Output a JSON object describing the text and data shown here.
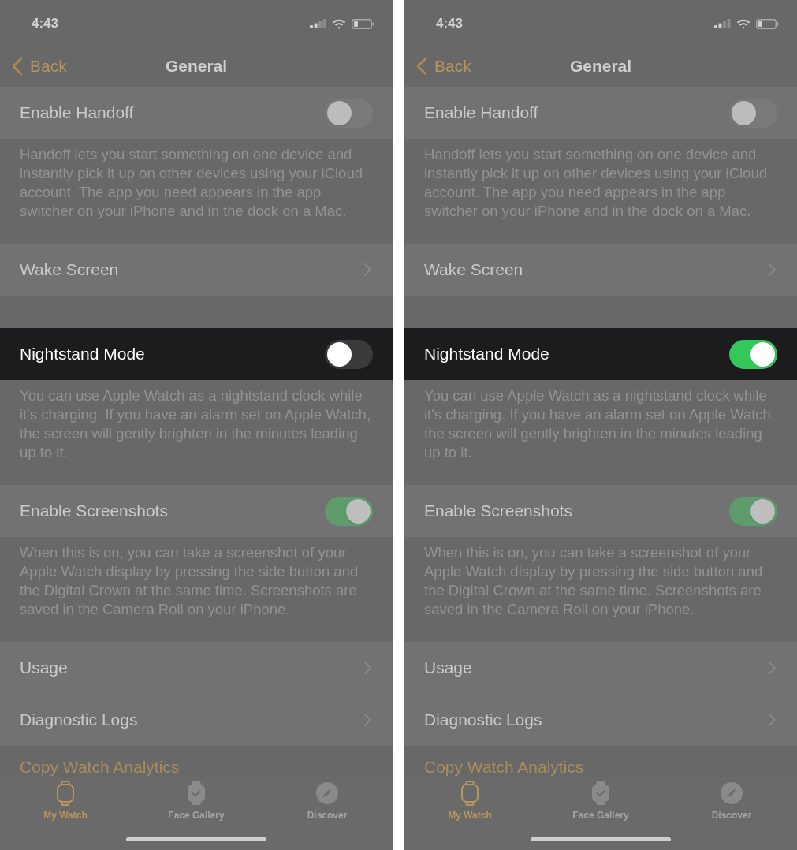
{
  "screens": [
    {
      "status_bar": {
        "time": "4:43"
      },
      "nav_bar": {
        "back": "Back",
        "title": "General"
      },
      "sections": [
        {
          "rows": [
            {
              "kind": "toggle",
              "label": "Enable Handoff",
              "on": false,
              "highlighted": false
            }
          ],
          "footer": "Handoff lets you start something on one device and instantly pick it up on other devices using your iCloud account. The app you need appears in the app switcher on your iPhone and in the dock on a Mac."
        },
        {
          "rows": [
            {
              "kind": "link",
              "label": "Wake Screen",
              "highlighted": false
            }
          ]
        },
        {
          "rows": [
            {
              "kind": "toggle",
              "label": "Nightstand Mode",
              "on": false,
              "highlighted": true
            }
          ],
          "footer": "You can use Apple Watch as a nightstand clock while it's charging. If you have an alarm set on Apple Watch, the screen will gently brighten in the minutes leading up to it."
        },
        {
          "rows": [
            {
              "kind": "toggle",
              "label": "Enable Screenshots",
              "on": true,
              "highlighted": false
            }
          ],
          "footer": "When this is on, you can take a screenshot of your Apple Watch display by pressing the side button and the Digital Crown at the same time. Screenshots are saved in the Camera Roll on your iPhone."
        },
        {
          "rows": [
            {
              "kind": "link",
              "label": "Usage",
              "highlighted": false
            },
            {
              "kind": "link",
              "label": "Diagnostic Logs",
              "highlighted": false
            },
            {
              "kind": "action",
              "label": "Copy Watch Analytics",
              "highlighted": false
            }
          ]
        }
      ],
      "tab_bar": [
        {
          "label": "My Watch",
          "selected": true
        },
        {
          "label": "Face Gallery",
          "selected": false
        },
        {
          "label": "Discover",
          "selected": false
        }
      ]
    },
    {
      "status_bar": {
        "time": "4:43"
      },
      "nav_bar": {
        "back": "Back",
        "title": "General"
      },
      "sections": [
        {
          "rows": [
            {
              "kind": "toggle",
              "label": "Enable Handoff",
              "on": false,
              "highlighted": false
            }
          ],
          "footer": "Handoff lets you start something on one device and instantly pick it up on other devices using your iCloud account. The app you need appears in the app switcher on your iPhone and in the dock on a Mac."
        },
        {
          "rows": [
            {
              "kind": "link",
              "label": "Wake Screen",
              "highlighted": false
            }
          ]
        },
        {
          "rows": [
            {
              "kind": "toggle",
              "label": "Nightstand Mode",
              "on": true,
              "highlighted": true
            }
          ],
          "footer": "You can use Apple Watch as a nightstand clock while it's charging. If you have an alarm set on Apple Watch, the screen will gently brighten in the minutes leading up to it."
        },
        {
          "rows": [
            {
              "kind": "toggle",
              "label": "Enable Screenshots",
              "on": true,
              "highlighted": false
            }
          ],
          "footer": "When this is on, you can take a screenshot of your Apple Watch display by pressing the side button and the Digital Crown at the same time. Screenshots are saved in the Camera Roll on your iPhone."
        },
        {
          "rows": [
            {
              "kind": "link",
              "label": "Usage",
              "highlighted": false
            },
            {
              "kind": "link",
              "label": "Diagnostic Logs",
              "highlighted": false
            },
            {
              "kind": "action",
              "label": "Copy Watch Analytics",
              "highlighted": false
            }
          ]
        }
      ],
      "tab_bar": [
        {
          "label": "My Watch",
          "selected": true
        },
        {
          "label": "Face Gallery",
          "selected": false
        },
        {
          "label": "Discover",
          "selected": false
        }
      ]
    }
  ]
}
